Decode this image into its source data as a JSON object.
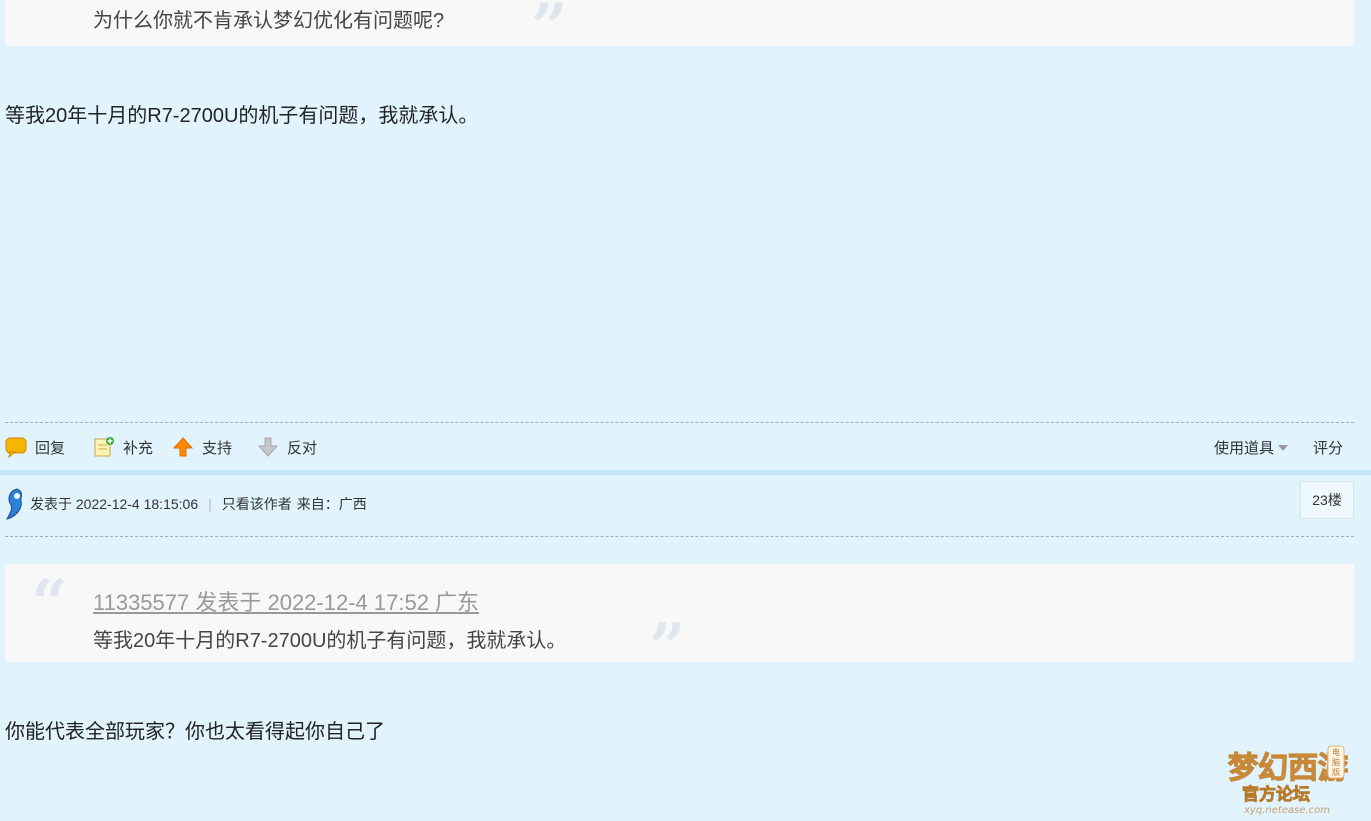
{
  "quote1": {
    "text": "为什么你就不肯承认梦幻优化有问题呢?"
  },
  "post1": {
    "text": "等我20年十月的R7-2700U的机子有问题，我就承认。"
  },
  "actions": {
    "reply": "回复",
    "supplement": "补充",
    "support": "支持",
    "oppose": "反对",
    "use_tools": "使用道具",
    "rate": "评分"
  },
  "post2_meta": {
    "posted_prefix": "发表于 2022-12-4 18:15:06",
    "only_author": "只看该作者",
    "from": "来自：广西",
    "floor": "23楼"
  },
  "quote2": {
    "head": "11335577 发表于 2022-12-4 17:52 广东",
    "text": "等我20年十月的R7-2700U的机子有问题，我就承认。"
  },
  "post2": {
    "text": "你能代表全部玩家？你也太看得起你自己了"
  },
  "logo": {
    "title": "梦幻西游",
    "subtitle": "官方论坛",
    "site": "xyq.netease.com",
    "badge": "电脑版"
  },
  "colors": {
    "background": "#e1f4fe",
    "quote_bg": "#f8f8f8",
    "separator": "#c5e6f7"
  }
}
